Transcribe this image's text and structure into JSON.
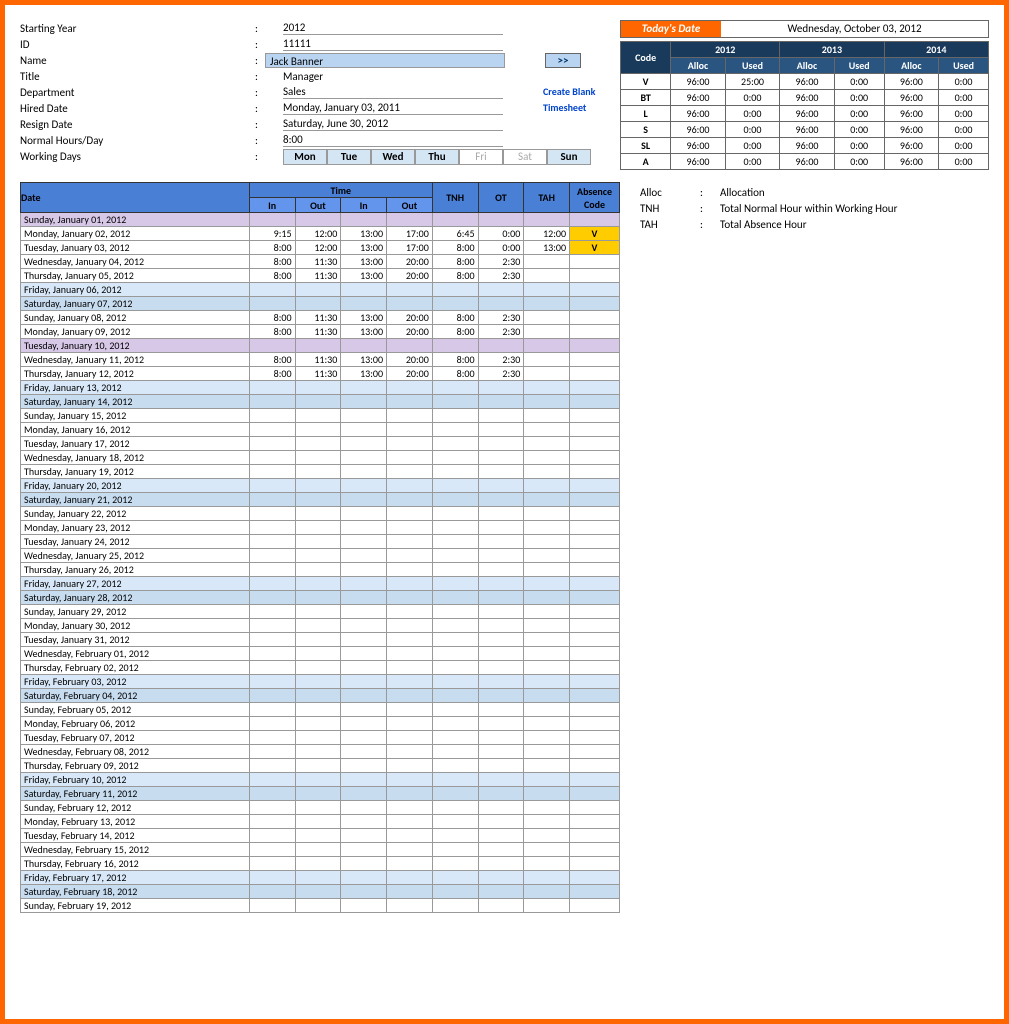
{
  "info": {
    "fields": [
      {
        "label": "Starting Year",
        "value": "2012",
        "ul": true
      },
      {
        "label": "ID",
        "value": "11111",
        "ul": true
      },
      {
        "label": "Name",
        "value": "Jack Banner",
        "type": "name"
      },
      {
        "label": "Title",
        "value": "Manager"
      },
      {
        "label": "Department",
        "value": "Sales",
        "ul": true,
        "btn1": "Create Blank"
      },
      {
        "label": "Hired Date",
        "value": "Monday, January 03, 2011",
        "ul": true,
        "btn2": "Timesheet"
      },
      {
        "label": "Resign Date",
        "value": "Saturday, June 30, 2012",
        "ul": true
      },
      {
        "label": "Normal Hours/Day",
        "value": "8:00",
        "ul": true
      },
      {
        "label": "Working Days",
        "type": "days"
      }
    ],
    "arrow": ">>",
    "days": [
      {
        "t": "Mon",
        "on": true
      },
      {
        "t": "Tue",
        "on": true
      },
      {
        "t": "Wed",
        "on": true
      },
      {
        "t": "Thu",
        "on": true
      },
      {
        "t": "Fri",
        "on": false
      },
      {
        "t": "Sat",
        "on": false
      },
      {
        "t": "Sun",
        "on": true
      }
    ]
  },
  "today": {
    "label": "Today's Date",
    "value": "Wednesday, October 03, 2012"
  },
  "alloc": {
    "code_hdr": "Code",
    "years": [
      "2012",
      "2013",
      "2014"
    ],
    "sub": [
      "Alloc",
      "Used"
    ],
    "rows": [
      {
        "code": "V",
        "v": [
          "96:00",
          "25:00",
          "96:00",
          "0:00",
          "96:00",
          "0:00"
        ]
      },
      {
        "code": "BT",
        "v": [
          "96:00",
          "0:00",
          "96:00",
          "0:00",
          "96:00",
          "0:00"
        ]
      },
      {
        "code": "L",
        "v": [
          "96:00",
          "0:00",
          "96:00",
          "0:00",
          "96:00",
          "0:00"
        ]
      },
      {
        "code": "S",
        "v": [
          "96:00",
          "0:00",
          "96:00",
          "0:00",
          "96:00",
          "0:00"
        ]
      },
      {
        "code": "SL",
        "v": [
          "96:00",
          "0:00",
          "96:00",
          "0:00",
          "96:00",
          "0:00"
        ]
      },
      {
        "code": "A",
        "v": [
          "96:00",
          "0:00",
          "96:00",
          "0:00",
          "96:00",
          "0:00"
        ]
      }
    ]
  },
  "ts": {
    "hdr": {
      "date": "Date",
      "time": "Time",
      "in": "In",
      "out": "Out",
      "tnh": "TNH",
      "ot": "OT",
      "tah": "TAH",
      "abs": "Absence Code"
    },
    "rows": [
      {
        "d": "Sunday, January 01, 2012",
        "cls": "sun"
      },
      {
        "d": "Monday, January 02, 2012",
        "t": [
          "9:15",
          "12:00",
          "13:00",
          "17:00",
          "6:45",
          "0:00",
          "12:00"
        ],
        "ac": "V"
      },
      {
        "d": "Tuesday, January 03, 2012",
        "t": [
          "8:00",
          "12:00",
          "13:00",
          "17:00",
          "8:00",
          "0:00",
          "13:00"
        ],
        "ac": "V"
      },
      {
        "d": "Wednesday, January 04, 2012",
        "t": [
          "8:00",
          "11:30",
          "13:00",
          "20:00",
          "8:00",
          "2:30",
          ""
        ]
      },
      {
        "d": "Thursday, January 05, 2012",
        "t": [
          "8:00",
          "11:30",
          "13:00",
          "20:00",
          "8:00",
          "2:30",
          ""
        ]
      },
      {
        "d": "Friday, January 06, 2012",
        "cls": "fri"
      },
      {
        "d": "Saturday, January 07, 2012",
        "cls": "sat"
      },
      {
        "d": "Sunday, January 08, 2012",
        "t": [
          "8:00",
          "11:30",
          "13:00",
          "20:00",
          "8:00",
          "2:30",
          ""
        ]
      },
      {
        "d": "Monday, January 09, 2012",
        "t": [
          "8:00",
          "11:30",
          "13:00",
          "20:00",
          "8:00",
          "2:30",
          ""
        ]
      },
      {
        "d": "Tuesday, January 10, 2012",
        "cls": "sun"
      },
      {
        "d": "Wednesday, January 11, 2012",
        "t": [
          "8:00",
          "11:30",
          "13:00",
          "20:00",
          "8:00",
          "2:30",
          ""
        ]
      },
      {
        "d": "Thursday, January 12, 2012",
        "t": [
          "8:00",
          "11:30",
          "13:00",
          "20:00",
          "8:00",
          "2:30",
          ""
        ]
      },
      {
        "d": "Friday, January 13, 2012",
        "cls": "fri"
      },
      {
        "d": "Saturday, January 14, 2012",
        "cls": "sat"
      },
      {
        "d": "Sunday, January 15, 2012"
      },
      {
        "d": "Monday, January 16, 2012"
      },
      {
        "d": "Tuesday, January 17, 2012"
      },
      {
        "d": "Wednesday, January 18, 2012"
      },
      {
        "d": "Thursday, January 19, 2012"
      },
      {
        "d": "Friday, January 20, 2012",
        "cls": "fri"
      },
      {
        "d": "Saturday, January 21, 2012",
        "cls": "sat"
      },
      {
        "d": "Sunday, January 22, 2012"
      },
      {
        "d": "Monday, January 23, 2012"
      },
      {
        "d": "Tuesday, January 24, 2012"
      },
      {
        "d": "Wednesday, January 25, 2012"
      },
      {
        "d": "Thursday, January 26, 2012"
      },
      {
        "d": "Friday, January 27, 2012",
        "cls": "fri"
      },
      {
        "d": "Saturday, January 28, 2012",
        "cls": "sat"
      },
      {
        "d": "Sunday, January 29, 2012"
      },
      {
        "d": "Monday, January 30, 2012"
      },
      {
        "d": "Tuesday, January 31, 2012"
      },
      {
        "d": "Wednesday, February 01, 2012"
      },
      {
        "d": "Thursday, February 02, 2012"
      },
      {
        "d": "Friday, February 03, 2012",
        "cls": "fri"
      },
      {
        "d": "Saturday, February 04, 2012",
        "cls": "sat"
      },
      {
        "d": "Sunday, February 05, 2012"
      },
      {
        "d": "Monday, February 06, 2012"
      },
      {
        "d": "Tuesday, February 07, 2012"
      },
      {
        "d": "Wednesday, February 08, 2012"
      },
      {
        "d": "Thursday, February 09, 2012"
      },
      {
        "d": "Friday, February 10, 2012",
        "cls": "fri"
      },
      {
        "d": "Saturday, February 11, 2012",
        "cls": "sat"
      },
      {
        "d": "Sunday, February 12, 2012"
      },
      {
        "d": "Monday, February 13, 2012"
      },
      {
        "d": "Tuesday, February 14, 2012"
      },
      {
        "d": "Wednesday, February 15, 2012"
      },
      {
        "d": "Thursday, February 16, 2012"
      },
      {
        "d": "Friday, February 17, 2012",
        "cls": "fri"
      },
      {
        "d": "Saturday, February 18, 2012",
        "cls": "sat"
      },
      {
        "d": "Sunday, February 19, 2012"
      }
    ]
  },
  "legend": [
    {
      "k": "Alloc",
      "v": "Allocation"
    },
    {
      "k": "TNH",
      "v": "Total Normal Hour within Working Hour"
    },
    {
      "k": "TAH",
      "v": "Total Absence Hour"
    }
  ]
}
